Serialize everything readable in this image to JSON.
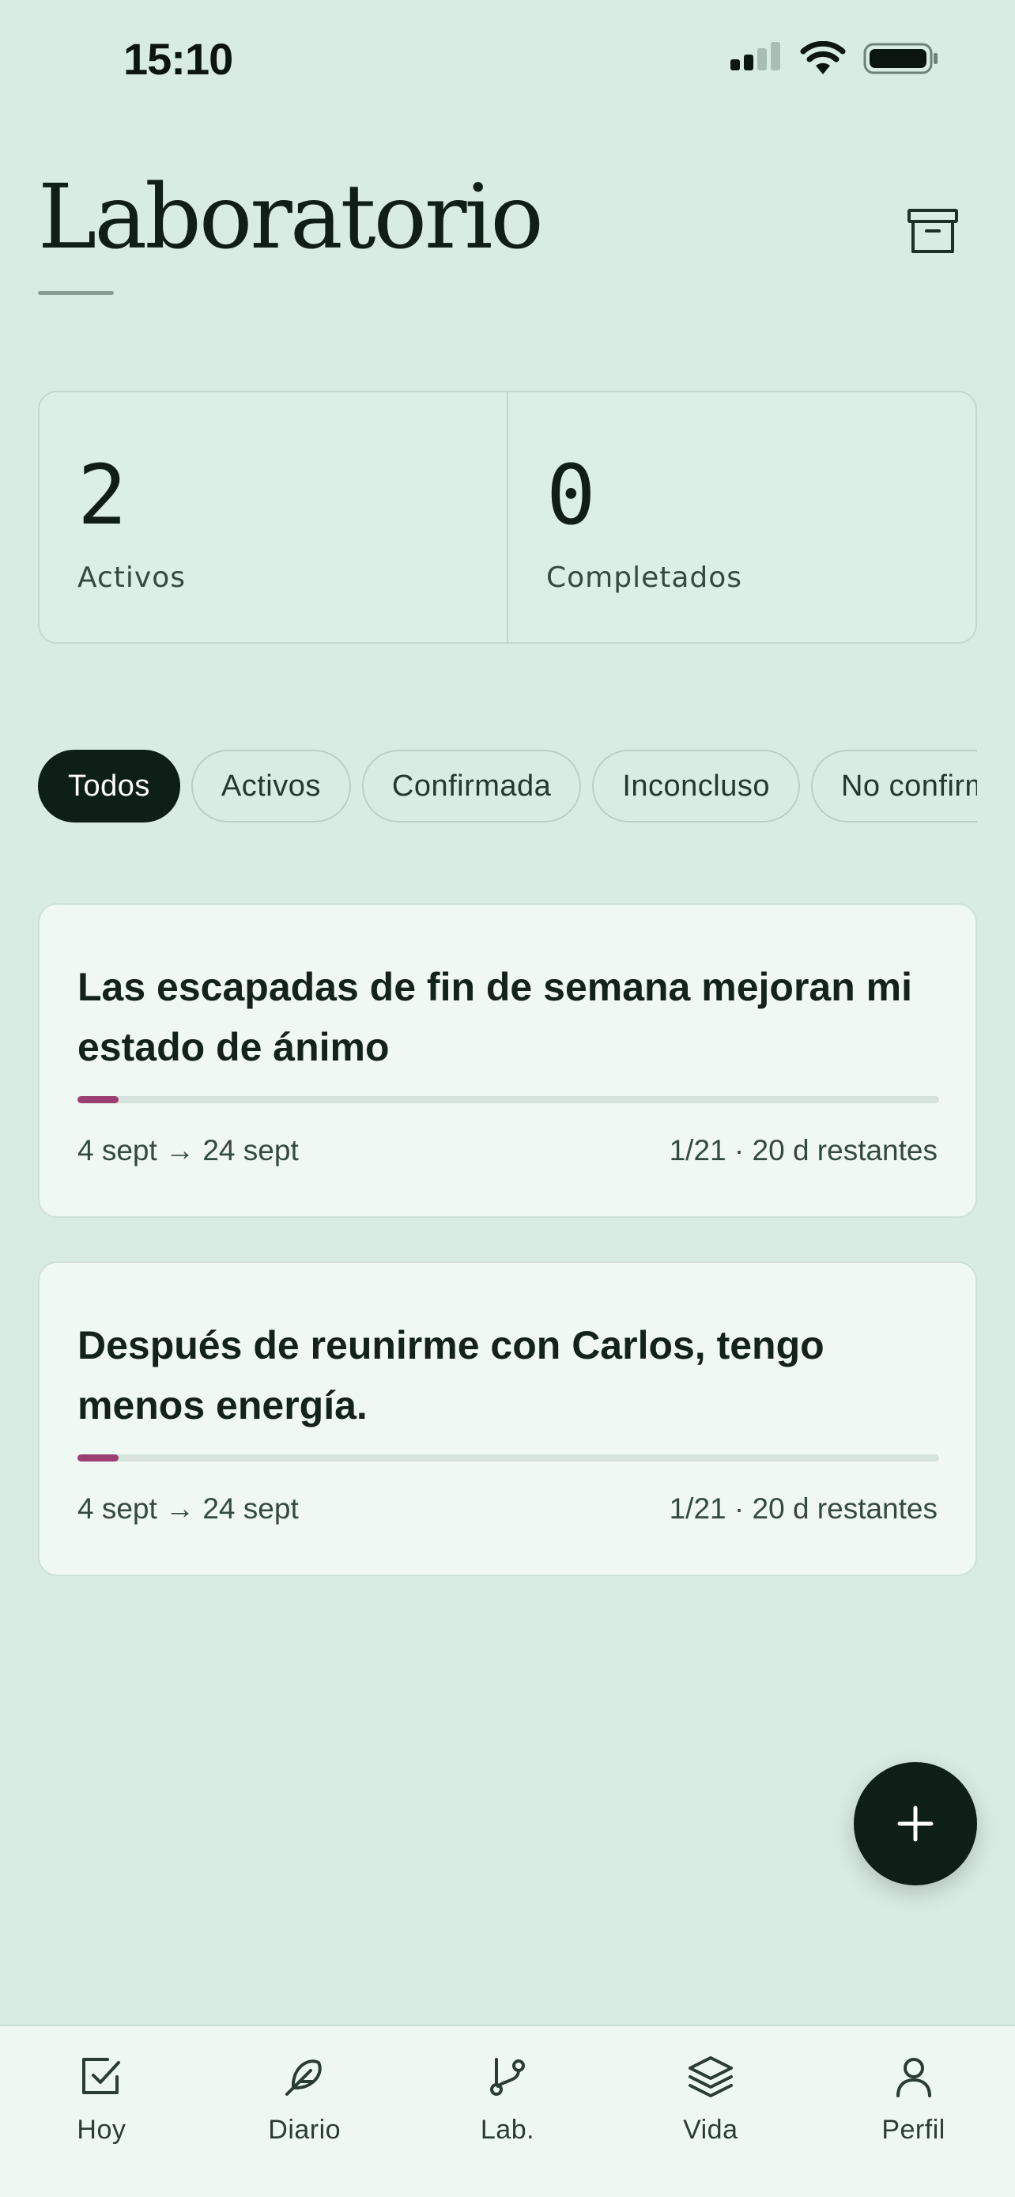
{
  "status_bar": {
    "time": "15:10"
  },
  "header": {
    "title": "Laboratorio",
    "archive_icon": "archive-icon"
  },
  "stats": [
    {
      "value": "2",
      "label": "Activos"
    },
    {
      "value": "0",
      "label": "Completados"
    }
  ],
  "filters": [
    {
      "label": "Todos",
      "active": true
    },
    {
      "label": "Activos",
      "active": false
    },
    {
      "label": "Confirmada",
      "active": false
    },
    {
      "label": "Inconcluso",
      "active": false
    },
    {
      "label": "No confirmada",
      "active": false
    }
  ],
  "experiments": [
    {
      "title": "Las escapadas de fin de semana mejoran mi estado de ánimo",
      "dates": "4 sept → 24 sept",
      "meta": "1/21 · 20 d restantes",
      "progress": 0.0476
    },
    {
      "title": "Después de reunirme con Carlos, tengo menos energía.",
      "dates": "4 sept → 24 sept",
      "meta": "1/21 · 20 d restantes",
      "progress": 0.0476
    }
  ],
  "fab": {
    "icon": "plus-icon"
  },
  "tabbar": [
    {
      "label": "Hoy",
      "icon": "checkbox-icon"
    },
    {
      "label": "Diario",
      "icon": "feather-icon"
    },
    {
      "label": "Lab.",
      "icon": "branch-icon"
    },
    {
      "label": "Vida",
      "icon": "layers-icon"
    },
    {
      "label": "Perfil",
      "icon": "user-icon"
    }
  ],
  "colors": {
    "background": "#d8ece1",
    "card": "#eff8f3",
    "accent_dark": "#0d1f17",
    "progress": "#9b3f72"
  }
}
